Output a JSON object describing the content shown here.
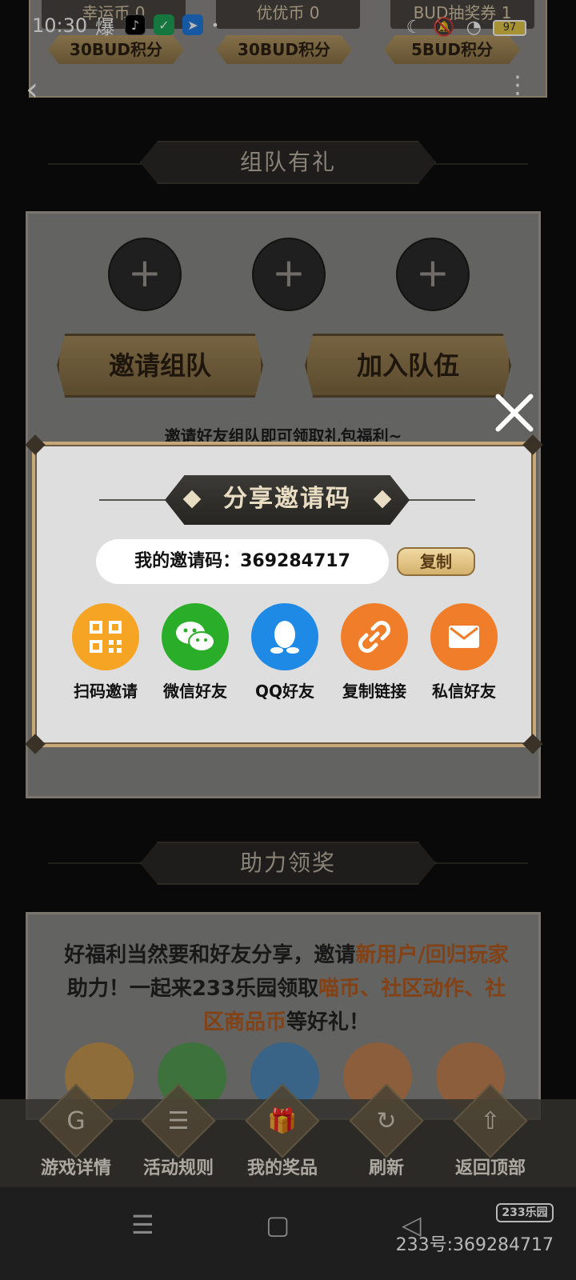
{
  "status_bar": {
    "time": "10:30",
    "status_char": "爆",
    "battery": "97"
  },
  "top_panel": {
    "coins": [
      "幸运币 0",
      "优优币 0",
      "BUD抽奖券 1"
    ],
    "rewards": [
      "30BUD积分",
      "30BUD积分",
      "5BUD积分"
    ]
  },
  "team_section": {
    "title": "组队有礼",
    "invite_button": "邀请组队",
    "join_button": "加入队伍",
    "hint": "邀请好友组队即可领取礼包福利~"
  },
  "modal": {
    "title": "分享邀请码",
    "code_text": "我的邀请码：369284717",
    "copy_label": "复制",
    "share_options": [
      {
        "label": "扫码邀请",
        "icon": "qr-code-icon",
        "color": "#f5a424"
      },
      {
        "label": "微信好友",
        "icon": "wechat-icon",
        "color": "#2aae2a"
      },
      {
        "label": "QQ好友",
        "icon": "qq-icon",
        "color": "#1f8ae5"
      },
      {
        "label": "复制链接",
        "icon": "link-icon",
        "color": "#f07d2a"
      },
      {
        "label": "私信好友",
        "icon": "mail-icon",
        "color": "#f07d2a"
      }
    ]
  },
  "help_section": {
    "title": "助力领奖",
    "text_1": "好福利当然要和好友分享，邀请",
    "text_hl_1": "新用户/回归玩家",
    "text_2": "助力！一起来233乐园领取",
    "text_hl_2": "喵币、社区动作、社区商品币",
    "text_3": "等好礼！"
  },
  "bottom_nav": [
    {
      "label": "游戏详情",
      "glyph": "G"
    },
    {
      "label": "活动规则",
      "glyph": "☰"
    },
    {
      "label": "我的奖品",
      "glyph": "🎁"
    },
    {
      "label": "刷新",
      "glyph": "↻"
    },
    {
      "label": "返回顶部",
      "glyph": "⇧"
    }
  ],
  "watermark": {
    "logo": "233乐园",
    "id": "233号:369284717"
  }
}
